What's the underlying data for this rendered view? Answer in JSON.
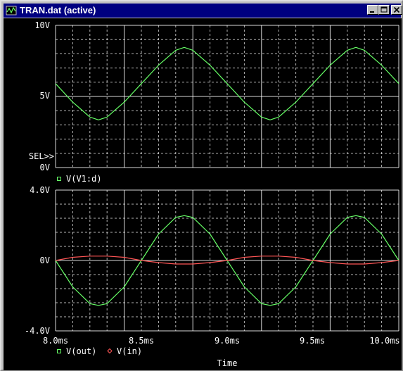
{
  "window": {
    "title": "TRAN.dat (active)",
    "controls": [
      "minimize",
      "maximize",
      "close"
    ],
    "icon": "probe-app-icon"
  },
  "colors": {
    "background": "#000000",
    "grid": "#ffffff",
    "label_text": "#ffffff",
    "series_green": "#66ff66",
    "series_red": "#ff5555",
    "titlebar": "#000080"
  },
  "x_axis": {
    "label": "Time",
    "ticks": [
      "8.0ms",
      "8.5ms",
      "9.0ms",
      "9.5ms",
      "10.0ms"
    ],
    "range_ms": [
      8.0,
      10.0
    ]
  },
  "plots": [
    {
      "id": "upper",
      "y_ticks": [
        "10V",
        "5V",
        "0V"
      ],
      "ylim": [
        0,
        10
      ],
      "selector": "SEL>>",
      "legend": [
        {
          "marker": "□",
          "label": "V(V1:d)",
          "color": "#66ff66"
        }
      ]
    },
    {
      "id": "lower",
      "y_ticks": [
        "4.0V",
        "0V",
        "-4.0V"
      ],
      "ylim": [
        -4,
        4
      ],
      "legend": [
        {
          "marker": "□",
          "label": "V(out)",
          "color": "#66ff66"
        },
        {
          "marker": "◇",
          "label": "V(in)",
          "color": "#ff5555"
        }
      ]
    }
  ],
  "chart_data": [
    {
      "type": "line",
      "xlabel": "Time",
      "x_unit": "ms",
      "xlim": [
        8.0,
        10.0
      ],
      "ylim": [
        0,
        10
      ],
      "grid": true,
      "series": [
        {
          "name": "V(V1:d)",
          "color": "#66ff66",
          "x": [
            8.0,
            8.1,
            8.2,
            8.25,
            8.3,
            8.4,
            8.5,
            8.6,
            8.7,
            8.75,
            8.8,
            8.9,
            9.0,
            9.1,
            9.2,
            9.25,
            9.3,
            9.4,
            9.5,
            9.6,
            9.7,
            9.75,
            9.8,
            9.9,
            10.0
          ],
          "y": [
            5.9,
            4.6,
            3.55,
            3.35,
            3.55,
            4.6,
            5.9,
            7.2,
            8.25,
            8.45,
            8.25,
            7.2,
            5.9,
            4.6,
            3.55,
            3.35,
            3.55,
            4.6,
            5.9,
            7.2,
            8.25,
            8.45,
            8.25,
            7.2,
            5.9
          ]
        }
      ]
    },
    {
      "type": "line",
      "xlabel": "Time",
      "x_unit": "ms",
      "xlim": [
        8.0,
        10.0
      ],
      "ylim": [
        -4,
        4
      ],
      "grid": true,
      "series": [
        {
          "name": "V(out)",
          "color": "#66ff66",
          "x": [
            8.0,
            8.1,
            8.2,
            8.25,
            8.3,
            8.4,
            8.5,
            8.6,
            8.7,
            8.75,
            8.8,
            8.9,
            9.0,
            9.1,
            9.2,
            9.25,
            9.3,
            9.4,
            9.5,
            9.6,
            9.7,
            9.75,
            9.8,
            9.9,
            10.0
          ],
          "y": [
            0,
            -1.5,
            -2.45,
            -2.55,
            -2.45,
            -1.5,
            0,
            1.5,
            2.45,
            2.55,
            2.45,
            1.5,
            0,
            -1.5,
            -2.45,
            -2.55,
            -2.45,
            -1.5,
            0,
            1.5,
            2.45,
            2.55,
            2.45,
            1.5,
            0
          ]
        },
        {
          "name": "V(in)",
          "color": "#ff5555",
          "x": [
            8.0,
            8.1,
            8.2,
            8.25,
            8.3,
            8.4,
            8.5,
            8.6,
            8.7,
            8.75,
            8.8,
            8.9,
            9.0,
            9.1,
            9.2,
            9.25,
            9.3,
            9.4,
            9.5,
            9.6,
            9.7,
            9.75,
            9.8,
            9.9,
            10.0
          ],
          "y": [
            0,
            0.18,
            0.25,
            0.25,
            0.25,
            0.18,
            0,
            -0.12,
            -0.2,
            -0.2,
            -0.2,
            -0.12,
            0,
            0.18,
            0.25,
            0.25,
            0.25,
            0.18,
            0,
            -0.12,
            -0.2,
            -0.2,
            -0.2,
            -0.12,
            0
          ]
        }
      ]
    }
  ]
}
